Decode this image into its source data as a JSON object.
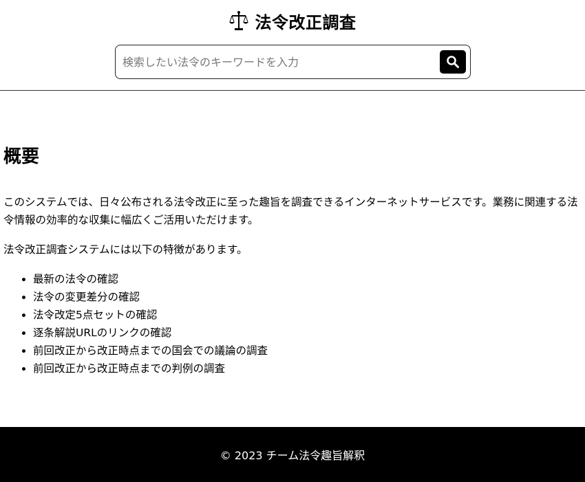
{
  "header": {
    "title": "法令改正調査",
    "logo_icon": "scales-of-justice-icon"
  },
  "search": {
    "placeholder": "検索したい法令のキーワードを入力",
    "value": "",
    "button_icon": "search-icon"
  },
  "main": {
    "heading": "概要",
    "intro": "このシステムでは、日々公布される法令改正に至った趣旨を調査できるインターネットサービスです。業務に関連する法令情報の効率的な収集に幅広くご活用いただけます。",
    "features_intro": "法令改正調査システムには以下の特徴があります。",
    "features": [
      "最新の法令の確認",
      "法令の変更差分の確認",
      "法令改定5点セットの確認",
      "逐条解説URLのリンクの確認",
      "前回改正から改正時点までの国会での議論の調査",
      "前回改正から改正時点までの判例の調査"
    ]
  },
  "footer": {
    "copyright": "© 2023 チーム法令趣旨解釈"
  },
  "colors": {
    "footer_bg": "#000000",
    "footer_text": "#ffffff",
    "search_button_bg": "#000000"
  }
}
